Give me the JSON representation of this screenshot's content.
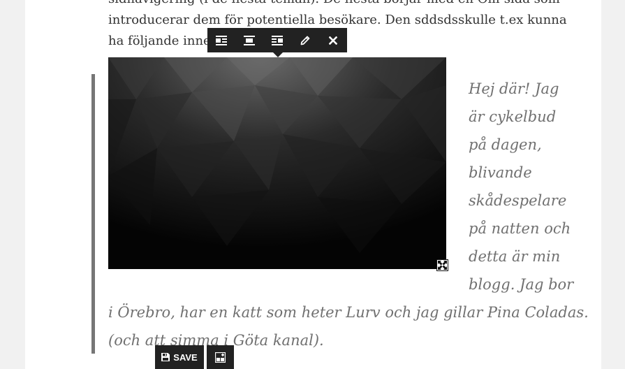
{
  "paragraph": {
    "lines": [
      "sidnavigering (i de flesta teman). De flesta börjar med en Om-sida som",
      "introducerar dem för potentiella besökare. Den sddsdsskulle t.ex kunna",
      "ha följande inne"
    ]
  },
  "quote": {
    "lines": [
      "Hej där! Jag",
      "är cykelbud",
      "på dagen,",
      "blivande",
      "skådespelare",
      "på natten och",
      "detta är min",
      "blogg. Jag bor",
      "i Örebro, har en katt som heter Lurv och jag gillar Pina Coladas.",
      "(och att simma i Göta kanal)."
    ]
  },
  "image_toolbar": {
    "icons": [
      "align-left-icon",
      "align-center-icon",
      "align-right-icon",
      "pencil-icon",
      "close-icon"
    ]
  },
  "bottom_bar": {
    "save_label": "SAVE"
  },
  "colors": {
    "toolbar_bg": "#222222",
    "quote_text": "#707070",
    "quote_bar": "#767676",
    "body_text": "#333333"
  }
}
